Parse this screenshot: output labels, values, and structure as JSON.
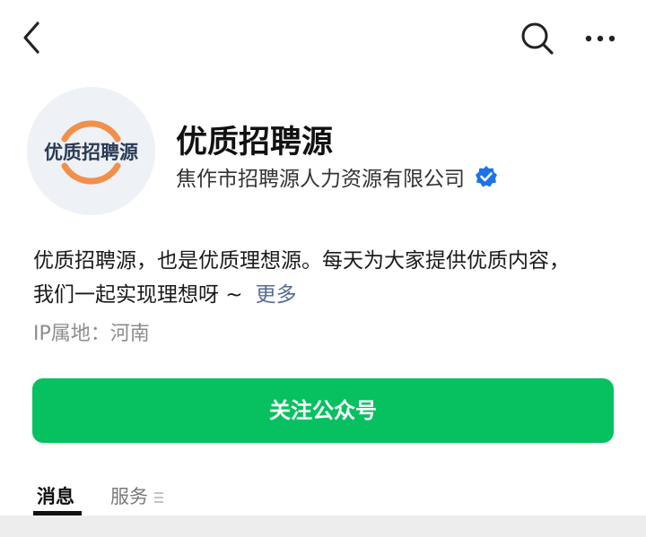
{
  "header": {
    "back_icon": "chevron-left-icon",
    "search_icon": "search-icon",
    "more_icon": "more-dots-icon"
  },
  "profile": {
    "avatar_text": "优质招聘源",
    "avatar_accent": "#f0904a",
    "name": "优质招聘源",
    "company": "焦作市招聘源人力资源有限公司",
    "verified_icon": "verified-badge-icon",
    "verified_color": "#1a73e8"
  },
  "intro": {
    "line1": "优质招聘源，也是优质理想源。每天为大家提供优质内容，",
    "line2": "我们一起实现理想呀 ~",
    "more_label": "更多"
  },
  "ip_location": "IP属地：河南",
  "follow_button": {
    "label": "关注公众号",
    "color": "#07c160"
  },
  "tabs": [
    {
      "label": "消息",
      "active": true
    },
    {
      "label": "服务",
      "active": false
    }
  ]
}
